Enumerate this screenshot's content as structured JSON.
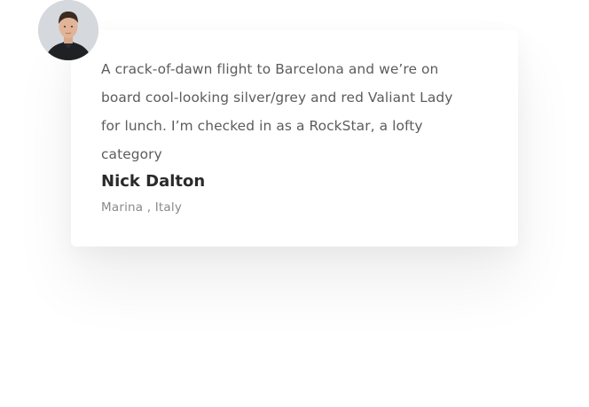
{
  "testimonial": {
    "quote": "A crack-of-dawn flight to Barcelona and we’re on board cool-looking silver/grey and red Valiant Lady for lunch. I’m checked in as a RockStar, a lofty category",
    "author_name": "Nick Dalton",
    "author_location": "Marina , Italy",
    "avatar_icon": "user-photo-avatar"
  },
  "colors": {
    "background": "#ffffff",
    "quote_text": "#5c5c5c",
    "name_text": "#2a2a2a",
    "location_text": "#8a8a8a"
  }
}
